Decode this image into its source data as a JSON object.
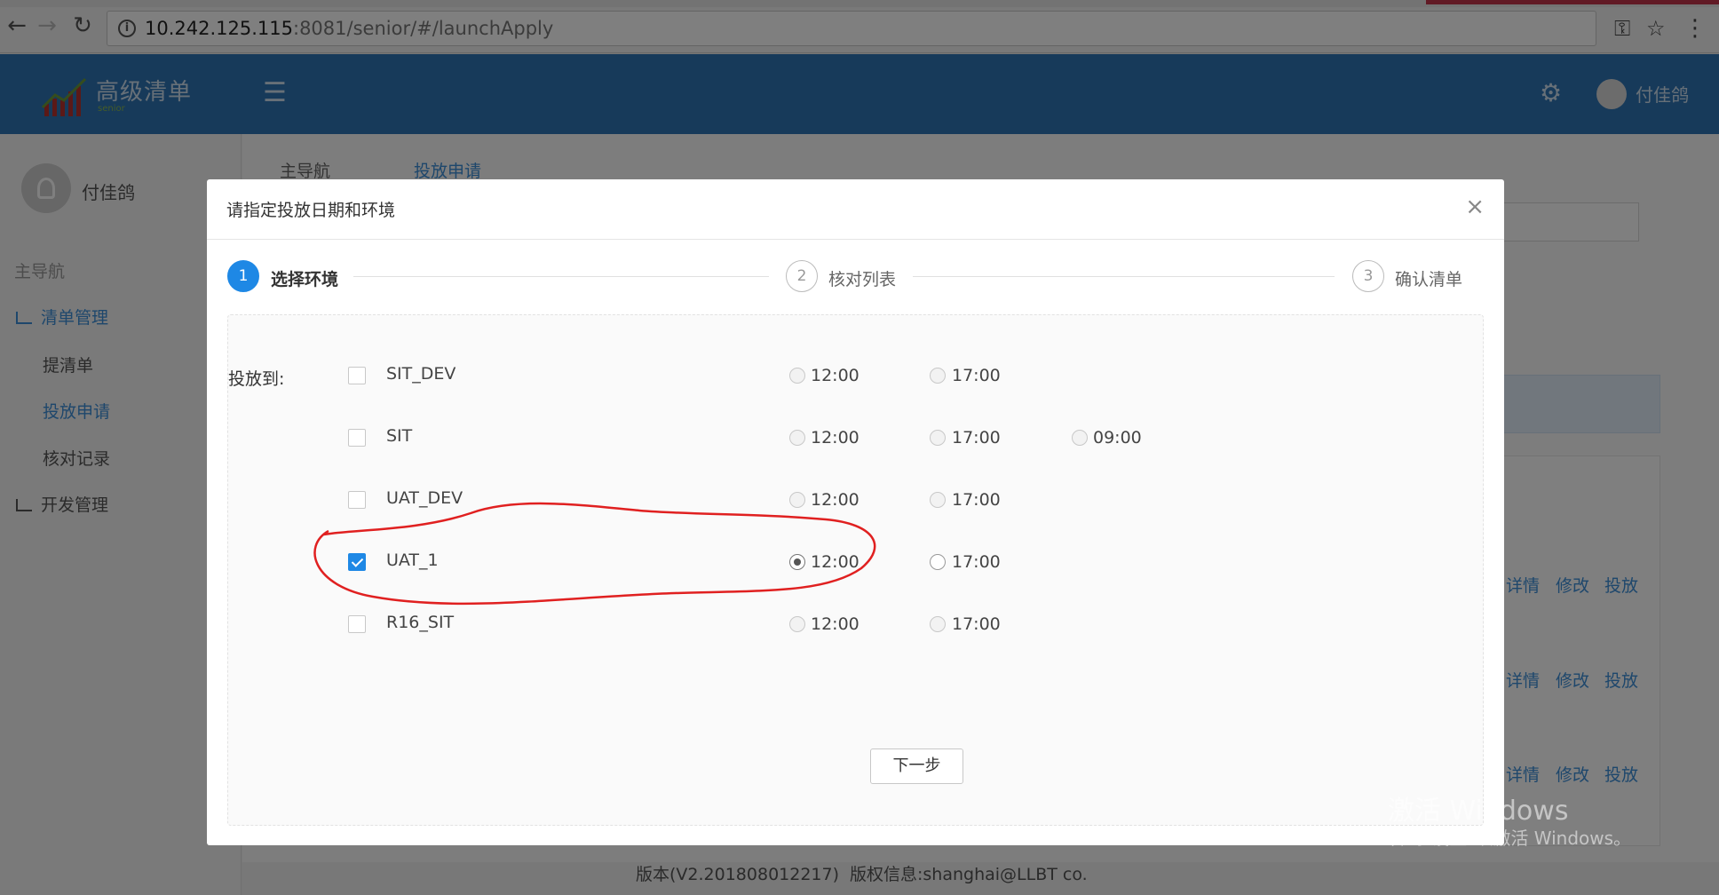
{
  "browser": {
    "url_host": "10.242.125.115",
    "url_rest": ":8081/senior/#/launchApply"
  },
  "header": {
    "logo_text": "高级清单",
    "logo_sub": "senior",
    "user": "付佳鸽"
  },
  "sidebar": {
    "user": "付佳鸽",
    "section": "主导航",
    "items": [
      {
        "label": "清单管理"
      },
      {
        "label": "提清单"
      },
      {
        "label": "投放申请"
      },
      {
        "label": "核对记录"
      },
      {
        "label": "开发管理"
      }
    ]
  },
  "breadcrumb": {
    "root": "主导航",
    "current": "投放申请"
  },
  "behind": {
    "links": [
      "详情",
      "修改",
      "投放"
    ]
  },
  "footer": {
    "version": "版本(V2.201808012217)",
    "copyright": "版权信息:shanghai@LLBT co."
  },
  "modal": {
    "title": "请指定投放日期和环境",
    "close": "×",
    "steps": [
      {
        "num": "1",
        "label": "选择环境"
      },
      {
        "num": "2",
        "label": "核对列表"
      },
      {
        "num": "3",
        "label": "确认清单"
      }
    ],
    "form_label": "投放到:",
    "environments": [
      {
        "name": "SIT_DEV",
        "checked": false,
        "times": [
          "12:00",
          "17:00"
        ]
      },
      {
        "name": "SIT",
        "checked": false,
        "times": [
          "12:00",
          "17:00",
          "09:00"
        ]
      },
      {
        "name": "UAT_DEV",
        "checked": false,
        "times": [
          "12:00",
          "17:00"
        ]
      },
      {
        "name": "UAT_1",
        "checked": true,
        "selected_time": "12:00",
        "times": [
          "12:00",
          "17:00"
        ]
      },
      {
        "name": "R16_SIT",
        "checked": false,
        "times": [
          "12:00",
          "17:00"
        ]
      }
    ],
    "next_button": "下一步"
  },
  "watermark": {
    "line1": "激活 Windows",
    "line2": "转到\"设置\"以激活 Windows。"
  },
  "colors": {
    "header_bg": "#2e74b5",
    "accent": "#1e88e5",
    "annotation": "#e02020"
  }
}
